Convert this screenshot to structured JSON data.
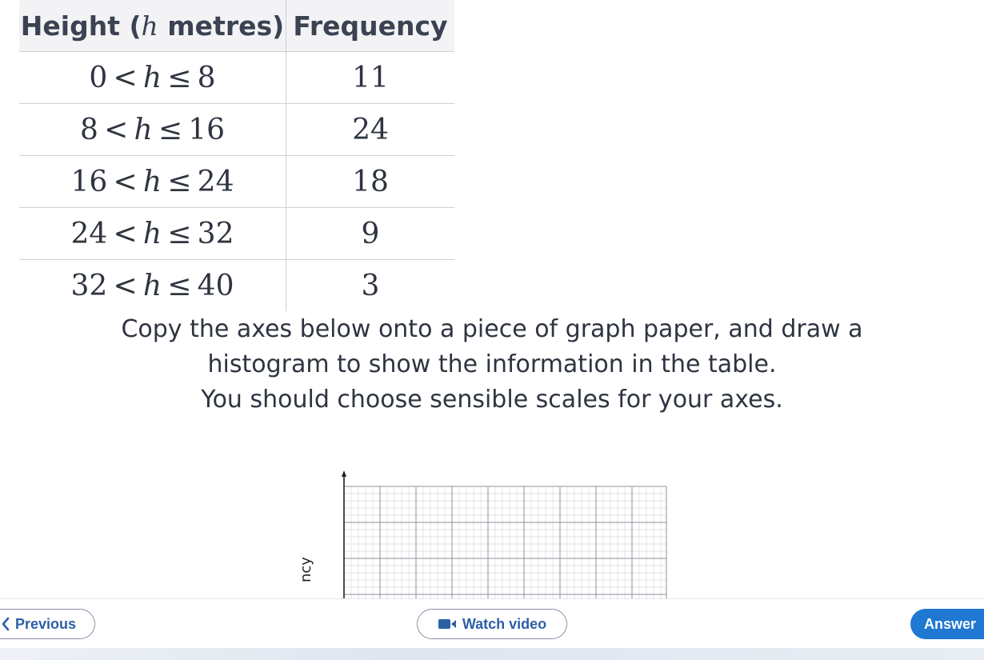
{
  "table": {
    "header_height_prefix": "Height (",
    "header_height_var": "h",
    "header_height_suffix": " metres)",
    "header_frequency": "Frequency",
    "rows": [
      {
        "lower": "0",
        "upper": "8",
        "frequency": "11"
      },
      {
        "lower": "8",
        "upper": "16",
        "frequency": "24"
      },
      {
        "lower": "16",
        "upper": "24",
        "frequency": "18"
      },
      {
        "lower": "24",
        "upper": "32",
        "frequency": "9"
      },
      {
        "lower": "32",
        "upper": "40",
        "frequency": "3"
      }
    ],
    "variable": "h",
    "lt_symbol": "<",
    "le_symbol": "≤"
  },
  "instructions": {
    "line1": "Copy the axes below onto a piece of graph paper, and draw a",
    "line2": "histogram to show the information in the table.",
    "line3": "You should choose sensible scales for your axes."
  },
  "graph": {
    "y_axis_label_partial": "ncy",
    "grid_color": "#9aa0a8",
    "axis_color": "#222222"
  },
  "nav": {
    "previous_label": "Previous",
    "watch_video_label": "Watch video",
    "answer_label": "Answer",
    "previous_icon": "chevron-left-icon",
    "video_icon": "video-camera-icon",
    "accent_color": "#1f78d1"
  }
}
